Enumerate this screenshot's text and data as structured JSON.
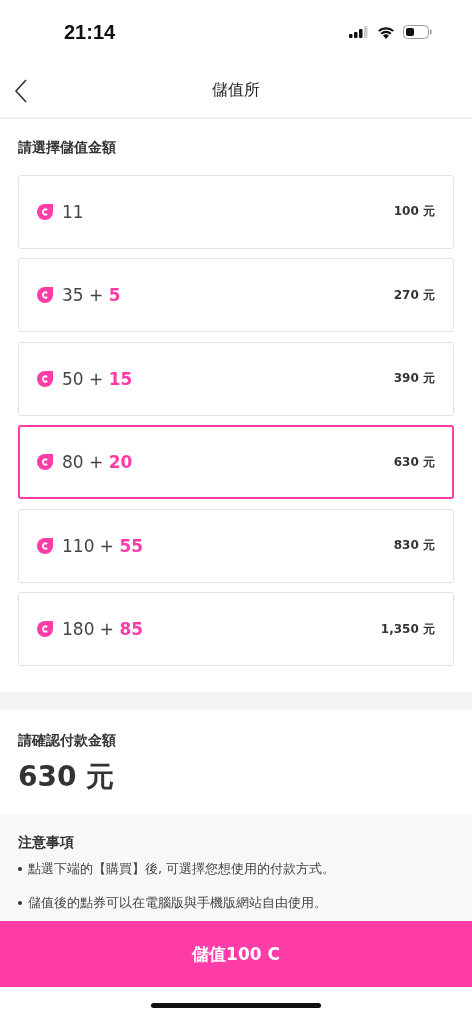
{
  "status_bar": {
    "time": "21:14"
  },
  "header": {
    "title": "儲值所"
  },
  "options_section": {
    "title": "請選擇儲值金額",
    "options": [
      {
        "base": "11",
        "price": "100 元",
        "selected": false
      },
      {
        "base": "35",
        "plus": "+",
        "bonus": "5",
        "price": "270 元",
        "selected": false
      },
      {
        "base": "50",
        "plus": "+",
        "bonus": "15",
        "price": "390 元",
        "selected": false
      },
      {
        "base": "80",
        "plus": "+",
        "bonus": "20",
        "price": "630 元",
        "selected": true
      },
      {
        "base": "110",
        "plus": "+",
        "bonus": "55",
        "price": "830 元",
        "selected": false
      },
      {
        "base": "180",
        "plus": "+",
        "bonus": "85",
        "price": "1,350 元",
        "selected": false
      }
    ]
  },
  "confirm": {
    "title": "請確認付款金額",
    "amount": "630 元"
  },
  "notes": {
    "title": "注意事項",
    "items": [
      "點選下端的【購買】後, 可選擇您想使用的付款方式。",
      "儲值後的點券可以在電腦版與手機版網站自由使用。"
    ]
  },
  "buy_button": {
    "label": "儲值100 C"
  }
}
